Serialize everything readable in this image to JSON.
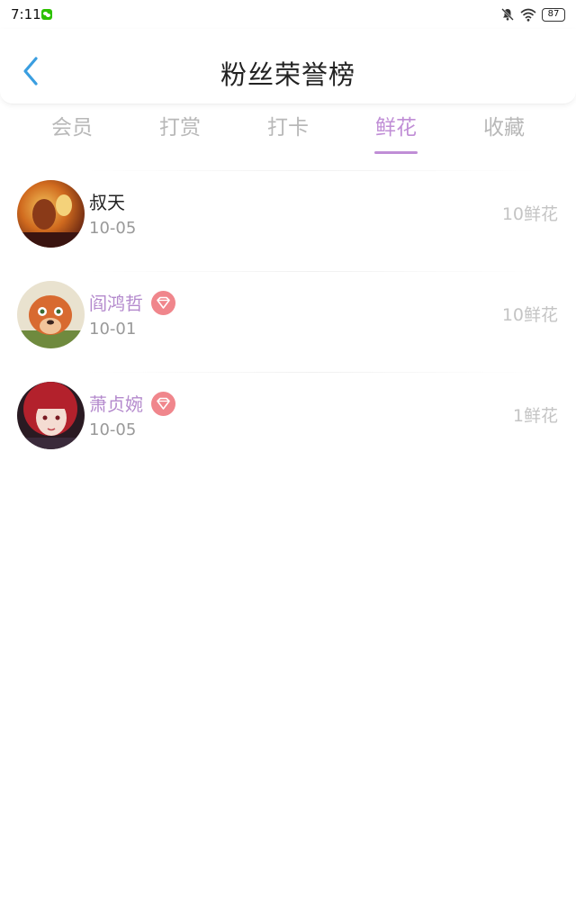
{
  "status_bar": {
    "time": "7:11",
    "battery": "87"
  },
  "header": {
    "title": "粉丝荣誉榜"
  },
  "tabs": [
    {
      "label": "会员"
    },
    {
      "label": "打赏"
    },
    {
      "label": "打卡"
    },
    {
      "label": "鲜花",
      "active": true
    },
    {
      "label": "收藏"
    }
  ],
  "colors": {
    "accent": "#c08ed6",
    "vip_name": "#b48acd",
    "badge": "#f0868c",
    "back_arrow": "#3a9ee0"
  },
  "fans": [
    {
      "name": "叔天",
      "date": "10-05",
      "count": "10鲜花",
      "vip": false
    },
    {
      "name": "阎鸿哲",
      "date": "10-01",
      "count": "10鲜花",
      "vip": true
    },
    {
      "name": "萧贞婉",
      "date": "10-05",
      "count": "1鲜花",
      "vip": true
    }
  ]
}
